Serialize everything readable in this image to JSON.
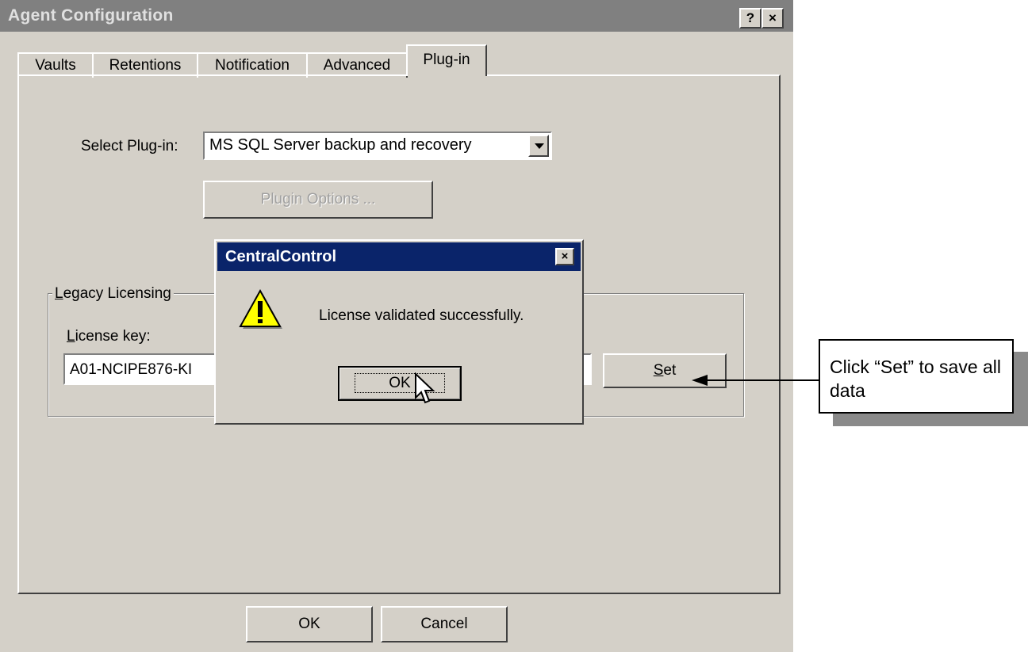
{
  "window": {
    "title": "Agent Configuration",
    "help_button": "?",
    "close_button": "×"
  },
  "tabs": [
    {
      "label": "Vaults"
    },
    {
      "label": "Retentions"
    },
    {
      "label": "Notification"
    },
    {
      "label": "Advanced"
    },
    {
      "label": "Plug-in",
      "active": true
    }
  ],
  "plugin": {
    "select_label": "Select Plug-in:",
    "selected_value": "MS SQL Server backup and recovery",
    "options_button": "Plugin Options ..."
  },
  "licensing": {
    "group_title_first": "L",
    "group_title_rest": "egacy Licensing",
    "key_label_first": "L",
    "key_label_rest": "icense key:",
    "key_value": "A01-NCIPE876-KI",
    "set_button_first": "S",
    "set_button_rest": "et"
  },
  "dialog": {
    "title": "CentralControl",
    "message": "License validated successfully.",
    "ok_button": "OK",
    "close_button": "×"
  },
  "footer": {
    "ok_button": "OK",
    "cancel_button": "Cancel"
  },
  "callout": {
    "text": "Click “Set” to save all data"
  }
}
